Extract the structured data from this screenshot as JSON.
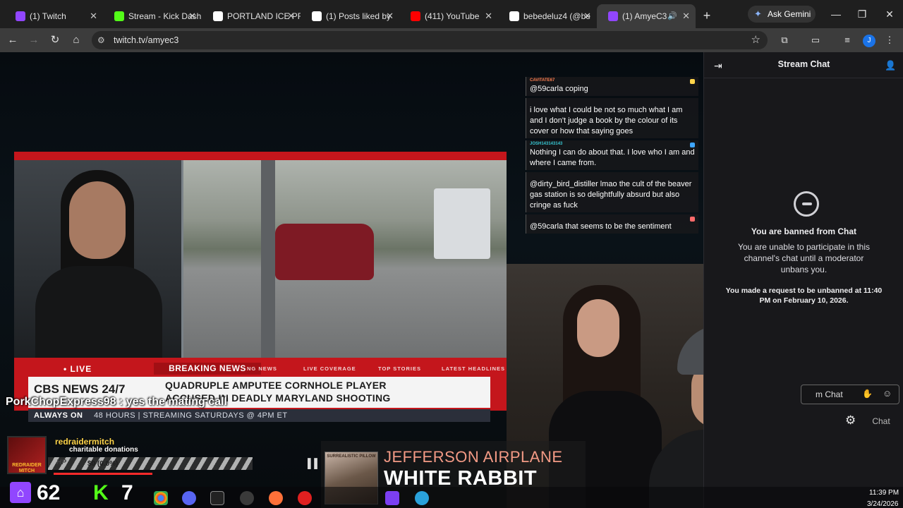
{
  "browser": {
    "tabs": [
      {
        "title": "(1) Twitch",
        "favicon_color": "#9146ff",
        "active": false
      },
      {
        "title": "Stream - Kick Dash",
        "favicon_color": "#53fc18",
        "active": false
      },
      {
        "title": "PORTLAND ICE PR",
        "favicon_color": "#ffffff",
        "active": false
      },
      {
        "title": "(1) Posts liked by",
        "favicon_color": "#ffffff",
        "active": false
      },
      {
        "title": "(411) YouTube",
        "favicon_color": "#ff0000",
        "active": false
      },
      {
        "title": "bebedeluz4 (@be",
        "favicon_color": "#ffffff",
        "active": false
      },
      {
        "title": "(1) AmyeC3 -",
        "favicon_color": "#9146ff",
        "active": true
      }
    ],
    "new_tab_label": "+",
    "gemini_label": "Ask Gemini",
    "url": "twitch.tv/amyec3",
    "profile_initial": "J",
    "window_controls": [
      "—",
      "❐",
      "✕"
    ]
  },
  "stream": {
    "news": {
      "live_label": "• LIVE",
      "breaking_label": "BREAKING NEWS",
      "ticker_items": [
        "NG NEWS",
        "LIVE COVERAGE",
        "TOP STORIES",
        "LATEST HEADLINES"
      ],
      "network": "CBS NEWS 24/7",
      "headline_line1": "QUADRUPLE AMPUTEE CORNHOLE PLAYER",
      "headline_line2": "ACCUSED IN DEADLY MARYLAND SHOOTING",
      "always_on_label": "ALWAYS ON",
      "always_on_text": "48 HOURS | STREAMING SATURDAYS @ 4PM ET"
    },
    "overlay_chat": [
      {
        "name": "CAVITATE67",
        "name_color": "#ff7f50",
        "text": "@59carla coping",
        "badge_color": "#ffd54a"
      },
      {
        "name": "",
        "name_color": "#ff3333",
        "text": "i love what I could be not so much what I am and I don't judge a book by the colour of its cover or how that saying goes",
        "badge_color": ""
      },
      {
        "name": "JOSH143143143",
        "name_color": "#37c8d4",
        "text": "Nothing I can do about that. I love who I am and where I came from.",
        "badge_color": "#3ea6ff"
      },
      {
        "name": "",
        "name_color": "#a970ff",
        "text": "@dirty_bird_distiller lmao the cult of the beaver gas station is so delightfully absurd but also cringe as fuck",
        "badge_color": ""
      },
      {
        "name": "",
        "name_color": "#2e5bff",
        "text": "@59carla that seems to be the sentiment",
        "badge_color": "#ff6b6b"
      }
    ],
    "chat_ticker": "PorkChopExpress98 : yes the mating call",
    "donation": {
      "avatar_text": "REDRAIDER MITCH",
      "donor": "redraidermitch",
      "tagline": "charitable donations",
      "hp_label": "HP",
      "hp_amount": "$0 (0.0%)",
      "hp_fraction": 0.0
    },
    "song": {
      "artist": "JEFFERSON AIRPLANE",
      "title": "WHITE RABBIT",
      "album_text": "SURREALISTIC PILLOW"
    },
    "pause_icon": "▌▌",
    "mini_chat_placeholder": "m Chat",
    "mini_chat_button": "Chat"
  },
  "chat_panel": {
    "title": "Stream Chat",
    "ban_title": "You are banned from Chat",
    "ban_body": "You are unable to participate in this channel's chat until a moderator unbans you.",
    "ban_request": "You made a request to be unbanned at 11:40 PM on February 10, 2026."
  },
  "taskbar": {
    "counter_a": "62",
    "counter_b": "7",
    "kick_letter": "K",
    "twitch_letter": "⌂",
    "time": "11:39 PM",
    "date": "3/24/2026"
  }
}
